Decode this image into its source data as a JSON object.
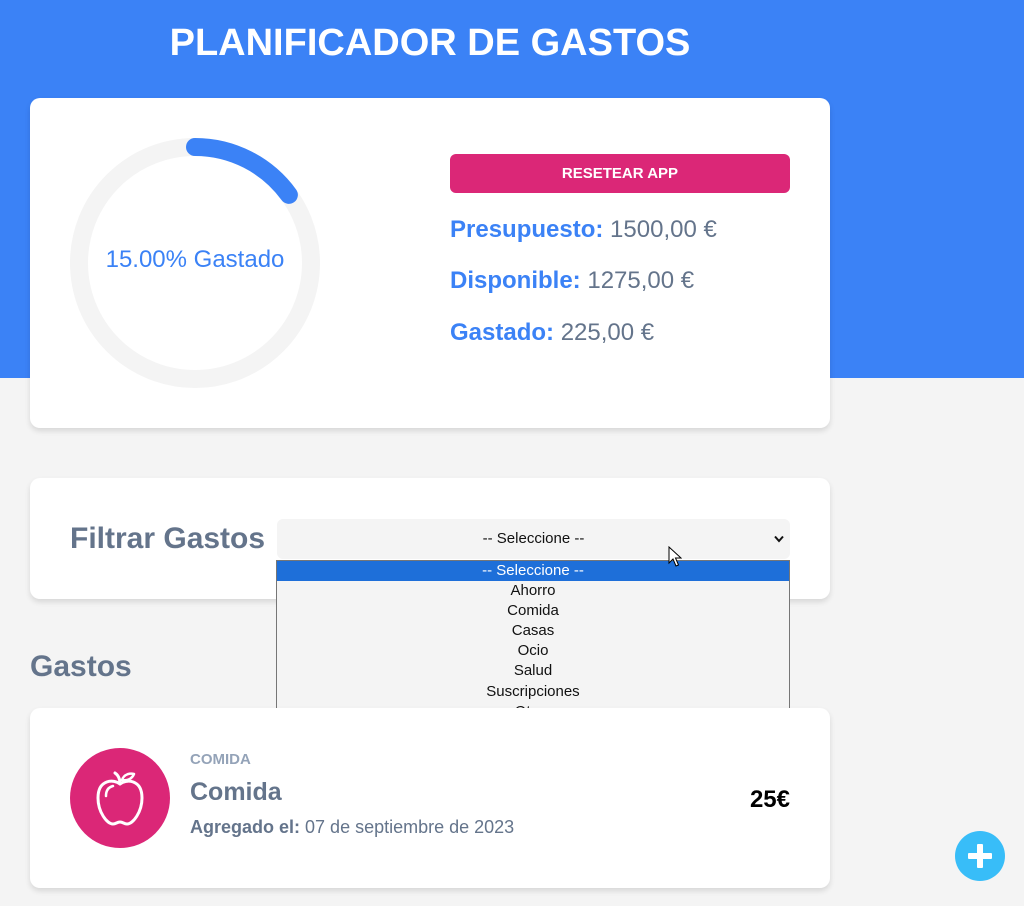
{
  "header": {
    "title": "PLANIFICADOR DE GASTOS"
  },
  "budget": {
    "progress_percent": 15,
    "progress_text": "15.00% Gastado",
    "reset_label": "RESETEAR APP",
    "presupuesto_label": "Presupuesto:",
    "presupuesto_value": "1500,00 €",
    "disponible_label": "Disponible:",
    "disponible_value": "1275,00 €",
    "gastado_label": "Gastado:",
    "gastado_value": "225,00 €"
  },
  "filter": {
    "label": "Filtrar Gastos",
    "selected": "-- Seleccione --",
    "options": [
      "-- Seleccione --",
      "Ahorro",
      "Comida",
      "Casas",
      "Ocio",
      "Salud",
      "Suscripciones",
      "Otros"
    ]
  },
  "expenses_section": {
    "title": "Gastos"
  },
  "expenses": [
    {
      "category": "COMIDA",
      "name": "Comida",
      "date_label": "Agregado el:",
      "date_value": "07 de septiembre de 2023",
      "amount": "25€",
      "icon": "apple-icon"
    }
  ],
  "colors": {
    "primary": "#3b82f6",
    "accent": "#db2777",
    "fab": "#38bdf8",
    "background": "#f4f4f4"
  },
  "icons": {
    "fab": "plus-icon",
    "cursor": "mouse-cursor-icon",
    "dropdown": "chevron-down-icon"
  }
}
